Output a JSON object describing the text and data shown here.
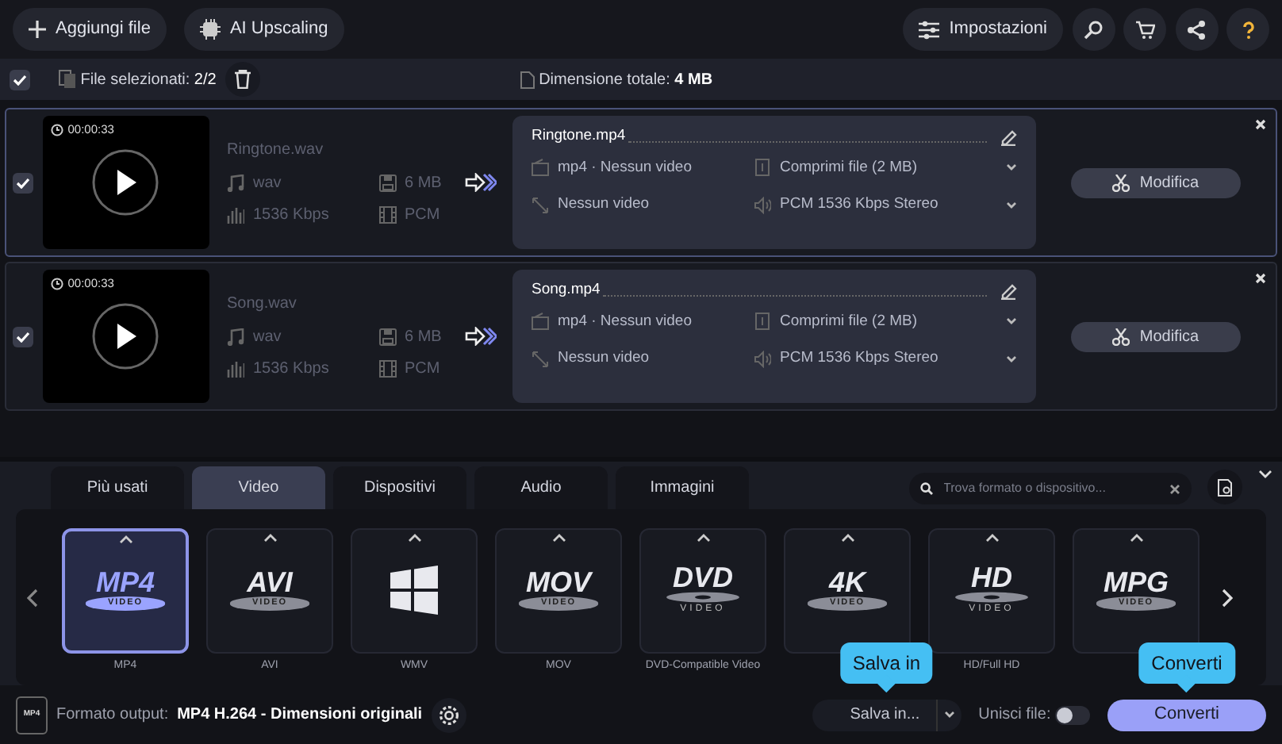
{
  "toolbar": {
    "add_button": "Aggiungi file",
    "upscale_button": "AI Upscaling",
    "settings_button": "Impostazioni"
  },
  "selection_bar": {
    "all_checked": true,
    "selected_label": "File selezionati:",
    "selected_value": "2/2",
    "size_label": "Dimensione totale:",
    "size_value": "4 MB"
  },
  "files": [
    {
      "checked": true,
      "highlighted": true,
      "duration": "00:00:33",
      "name": "Ringtone.wav",
      "format": "wav",
      "size": "6 MB",
      "bitrate": "1536 Kbps",
      "codec": "PCM",
      "output_name": "Ringtone.mp4",
      "output_format": "mp4 · Nessun video",
      "output_video": "Nessun video",
      "compress": "Comprimi file (2 MB)",
      "audio": "PCM 1536 Kbps Stereo",
      "edit_button": "Modifica"
    },
    {
      "checked": true,
      "highlighted": false,
      "duration": "00:00:33",
      "name": "Song.wav",
      "format": "wav",
      "size": "6 MB",
      "bitrate": "1536 Kbps",
      "codec": "PCM",
      "output_name": "Song.mp4",
      "output_format": "mp4 · Nessun video",
      "output_video": "Nessun video",
      "compress": "Comprimi file (2 MB)",
      "audio": "PCM 1536 Kbps Stereo",
      "edit_button": "Modifica"
    }
  ],
  "format_tabs": [
    {
      "label": "Più usati",
      "selected": false
    },
    {
      "label": "Video",
      "selected": true
    },
    {
      "label": "Dispositivi",
      "selected": false
    },
    {
      "label": "Audio",
      "selected": false
    },
    {
      "label": "Immagini",
      "selected": false
    }
  ],
  "search": {
    "placeholder": "Trova formato o dispositivo..."
  },
  "formats": [
    {
      "kind": "text",
      "logo": "MP4",
      "sub": "VIDEO",
      "label": "MP4",
      "selected": true
    },
    {
      "kind": "text",
      "logo": "AVI",
      "sub": "VIDEO",
      "label": "AVI",
      "selected": false
    },
    {
      "kind": "windows",
      "label": "WMV",
      "selected": false
    },
    {
      "kind": "text",
      "logo": "MOV",
      "sub": "VIDEO",
      "label": "MOV",
      "selected": false
    },
    {
      "kind": "disc",
      "logo": "DVD",
      "sub": "VIDEO",
      "label": "DVD-Compatible Video",
      "selected": false
    },
    {
      "kind": "text",
      "logo": "4K",
      "sub": "VIDEO",
      "selected": false
    },
    {
      "kind": "disc",
      "logo": "HD",
      "sub": "VIDEO",
      "label": "HD/Full HD",
      "selected": false
    },
    {
      "kind": "text",
      "logo": "MPG",
      "sub": "VIDEO",
      "selected": false
    }
  ],
  "footer": {
    "format_icon_text": "MP4",
    "output_label": "Formato output:",
    "output_value": "MP4 H.264 - Dimensioni originali",
    "save_button": "Salva in...",
    "save_tooltip": "Salva in",
    "merge_label": "Unisci file:",
    "merge_on": false,
    "convert_button": "Converti",
    "convert_tooltip": "Converti"
  }
}
